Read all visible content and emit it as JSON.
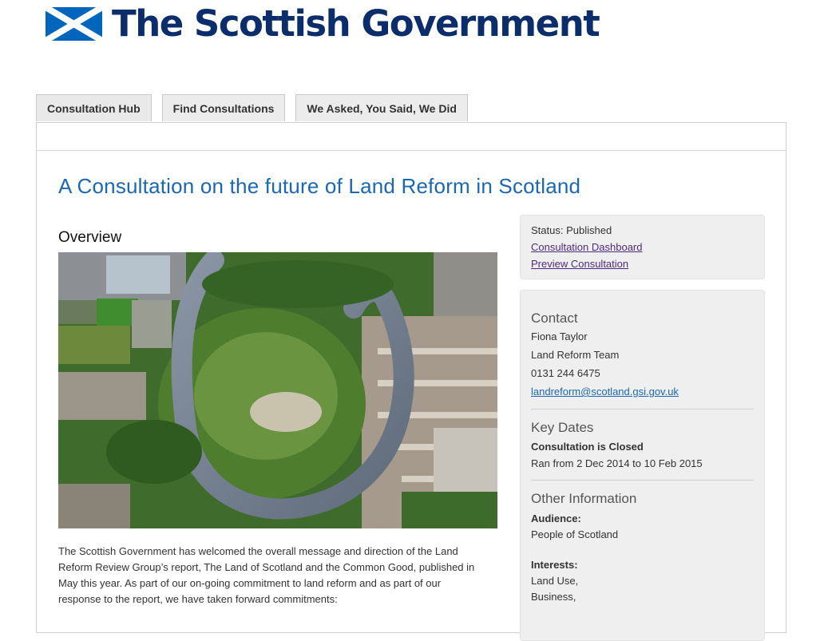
{
  "header": {
    "brand": "The Scottish Government",
    "flag_icon": "saltire-flag-icon",
    "colors": {
      "brand": "#0b2d6b",
      "flag_blue": "#0065bd"
    }
  },
  "tabs": [
    {
      "label": "Consultation Hub"
    },
    {
      "label": "Find Consultations"
    },
    {
      "label": "We Asked, You Said, We Did"
    }
  ],
  "page": {
    "title": "A Consultation on the future of Land Reform in Scotland",
    "title_color": "#1a68b5"
  },
  "overview": {
    "heading": "Overview",
    "image": "aerial-river-meander-photo",
    "body": "The Scottish Government has welcomed the overall message and direction of the Land Reform Review Group’s report, The Land of Scotland and the Common Good, published in May this year. As part of our on-going commitment to land reform and as part of our response to the report, we have taken forward commitments:"
  },
  "status": {
    "text": "Status: Published",
    "links": [
      "Consultation Dashboard",
      "Preview Consultation"
    ]
  },
  "contact": {
    "heading": "Contact",
    "name": "Fiona Taylor",
    "team": "Land Reform Team",
    "phone": "0131 244 6475",
    "email": "landreform@scotland.gsi.gov.uk"
  },
  "key_dates": {
    "heading": "Key Dates",
    "state": "Consultation is Closed",
    "range": "Ran from 2 Dec 2014 to 10 Feb 2015"
  },
  "other_info": {
    "heading": "Other Information",
    "audience_label": "Audience:",
    "audience": "People of Scotland",
    "interests_label": "Interests:",
    "interests": [
      "Land Use,",
      "Business,"
    ]
  }
}
